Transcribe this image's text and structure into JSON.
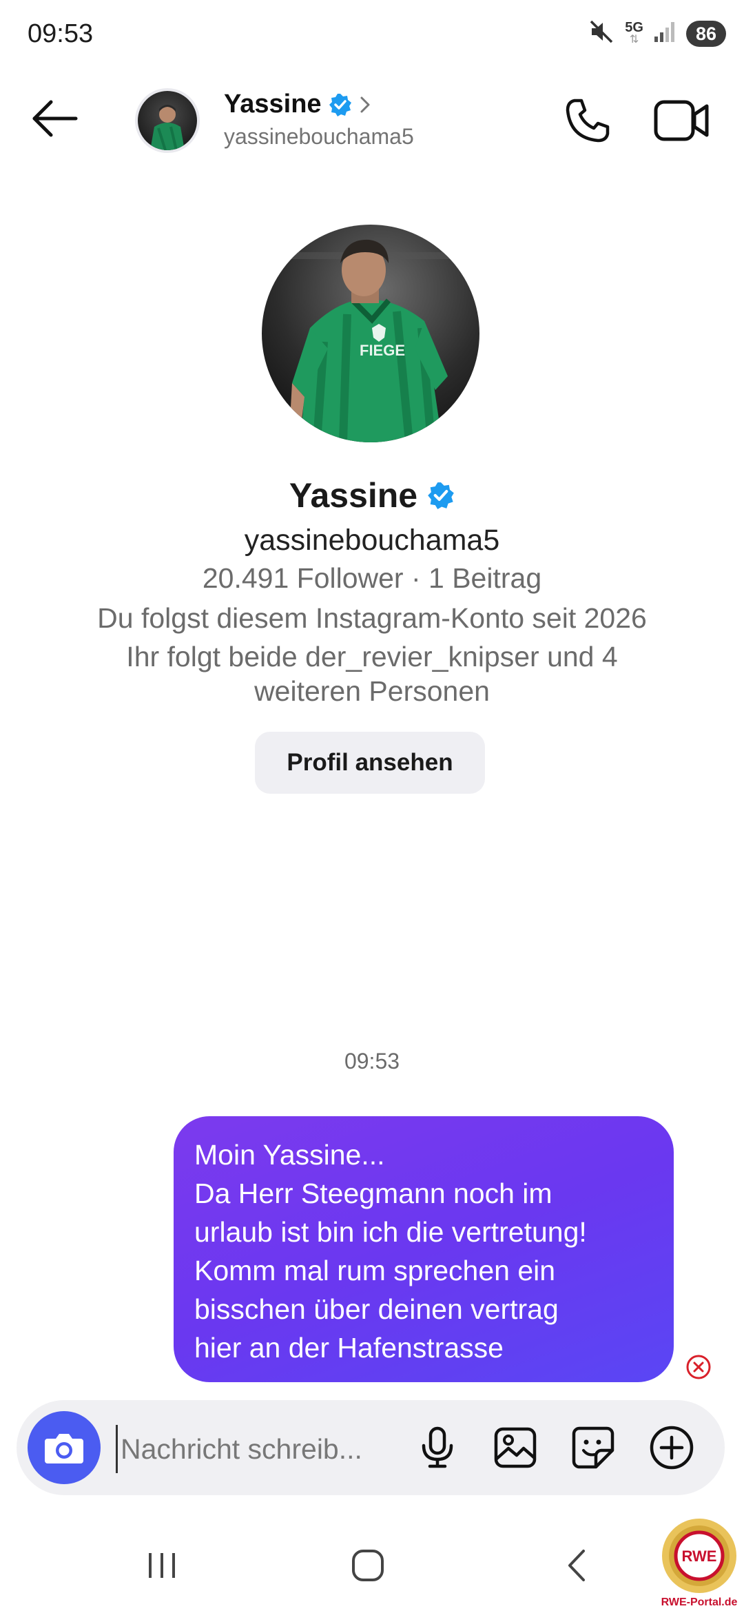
{
  "status_bar": {
    "time": "09:53",
    "network": "5G",
    "battery": "86",
    "icons": [
      "mute-icon",
      "network-5g-icon",
      "signal-icon",
      "battery-icon"
    ]
  },
  "header": {
    "name": "Yassine",
    "username": "yassinebouchama5",
    "verified": true,
    "icons": [
      "back-arrow-icon",
      "verified-badge-icon",
      "chevron-right-icon",
      "phone-icon",
      "video-camera-icon"
    ]
  },
  "profile": {
    "name": "Yassine",
    "username": "yassinebouchama5",
    "stats": "20.491 Follower · 1 Beitrag",
    "following_since": "Du folgst diesem Instagram-Konto seit 2026",
    "mutual_line1": "Ihr folgt beide der_revier_knipser und 4",
    "mutual_line2": "weiteren Personen",
    "button_label": "Profil ansehen",
    "jersey_text": "FIEGE"
  },
  "conversation": {
    "timestamp": "09:53",
    "message_lines": [
      "Moin Yassine...",
      "Da Herr Steegmann noch im",
      "urlaub ist bin ich die vertretung!",
      "Komm mal rum sprechen ein",
      "bisschen über deinen vertrag",
      "hier an der Hafenstrasse"
    ],
    "status": "failed"
  },
  "composer": {
    "placeholder": "Nachricht schreib...",
    "icons": [
      "camera-icon",
      "microphone-icon",
      "gallery-icon",
      "sticker-icon",
      "plus-icon"
    ]
  },
  "nav_bar": {
    "icons": [
      "recent-apps-icon",
      "home-icon",
      "back-icon"
    ]
  },
  "watermark": {
    "text": "RWE-Portal.de",
    "badge": "RWE"
  },
  "colors": {
    "accent_blue": "#4b5cf1",
    "bubble_start": "#7c3aee",
    "bubble_end": "#5a46f4",
    "verified": "#1d9bf0",
    "error": "#d9202a"
  }
}
